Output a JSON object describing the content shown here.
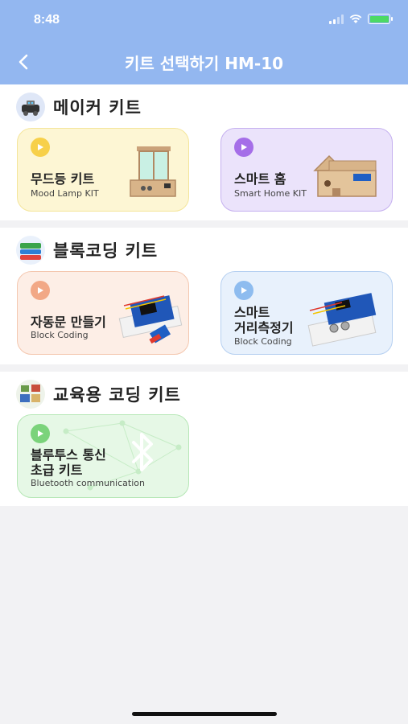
{
  "status_bar": {
    "time": "8:48"
  },
  "header": {
    "title": "키트 선택하기 HM-10"
  },
  "sections": [
    {
      "title": "메이커 키트",
      "icon": "maker-kit-icon",
      "cards": [
        {
          "title": "무드등 키트",
          "subtitle": "Mood Lamp KIT",
          "icon": "mood-lamp-icon"
        },
        {
          "title": "스마트 홈",
          "subtitle": "Smart Home KIT",
          "icon": "smart-home-icon"
        }
      ]
    },
    {
      "title": "블록코딩 키트",
      "icon": "block-coding-icon",
      "cards": [
        {
          "title": "자동문 만들기",
          "subtitle": "Block Coding",
          "icon": "auto-door-icon"
        },
        {
          "title": "스마트",
          "title2": "거리측정기",
          "subtitle": "Block Coding",
          "icon": "distance-sensor-icon"
        }
      ]
    },
    {
      "title": "교육용 코딩 키트",
      "icon": "education-kit-icon",
      "cards": [
        {
          "title": "블루투스 통신",
          "title2": "초급 키트",
          "subtitle": "Bluetooth communication",
          "icon": "bluetooth-icon"
        }
      ]
    }
  ],
  "colors": {
    "header": "#93b7f0",
    "yellow_card": "#fdf6d4",
    "purple_card": "#ebe3fb",
    "orange_card": "#fdeee6",
    "blue_card": "#e8f1fc",
    "green_card": "#e6f8e6"
  }
}
